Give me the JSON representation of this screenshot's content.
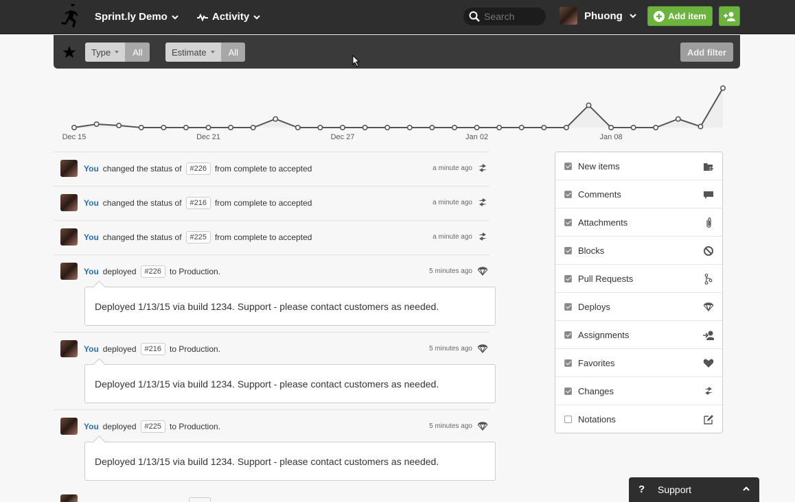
{
  "topbar": {
    "project": "Sprint.ly Demo",
    "activity": "Activity",
    "search_placeholder": "Search",
    "user_name": "Phuong",
    "add_item_label": "Add item"
  },
  "filterbar": {
    "type_label": "Type",
    "type_value": "All",
    "estimate_label": "Estimate",
    "estimate_value": "All",
    "add_filter_label": "Add filter"
  },
  "chart_data": {
    "type": "line",
    "x_tick_labels": [
      "Dec 15",
      "Dec 21",
      "Dec 27",
      "Jan 02",
      "Jan 08"
    ],
    "values": [
      0,
      1,
      0.6,
      0,
      0,
      0,
      0,
      0,
      0,
      2.5,
      0,
      0,
      0,
      0,
      0,
      0,
      0,
      0,
      0,
      0,
      0,
      0,
      0,
      6.5,
      0,
      0,
      0,
      2.5,
      0.3,
      11.5
    ],
    "ylim": [
      0,
      12
    ],
    "grid": false,
    "line_color": "#555555",
    "fill_color": "#eeeeee"
  },
  "feed": [
    {
      "kind": "status",
      "actor": "You",
      "text": "changed the status of",
      "tag": "#226",
      "rest": "from complete to accepted",
      "time": "a minute ago",
      "icon": "change-icon"
    },
    {
      "kind": "status",
      "actor": "You",
      "text": "changed the status of",
      "tag": "#216",
      "rest": "from complete to accepted",
      "time": "a minute ago",
      "icon": "change-icon"
    },
    {
      "kind": "status",
      "actor": "You",
      "text": "changed the status of",
      "tag": "#225",
      "rest": "from complete to accepted",
      "time": "a minute ago",
      "icon": "change-icon"
    },
    {
      "kind": "deploy",
      "actor": "You",
      "text": "deployed",
      "tag": "#226",
      "rest": "to Production.",
      "time": "5 minutes ago",
      "icon": "parachute-icon",
      "message": "Deployed 1/13/15 via build 1234. Support - please contact customers as needed."
    },
    {
      "kind": "deploy",
      "actor": "You",
      "text": "deployed",
      "tag": "#216",
      "rest": "to Production.",
      "time": "5 minutes ago",
      "icon": "parachute-icon",
      "message": "Deployed 1/13/15 via build 1234. Support - please contact customers as needed."
    },
    {
      "kind": "deploy",
      "actor": "You",
      "text": "deployed",
      "tag": "#225",
      "rest": "to Production.",
      "time": "5 minutes ago",
      "icon": "parachute-icon",
      "message": "Deployed 1/13/15 via build 1234. Support - please contact customers as needed."
    }
  ],
  "filters": [
    {
      "label": "New items",
      "checked": true,
      "icon": "new-item-icon"
    },
    {
      "label": "Comments",
      "checked": true,
      "icon": "comment-icon"
    },
    {
      "label": "Attachments",
      "checked": true,
      "icon": "paperclip-icon"
    },
    {
      "label": "Blocks",
      "checked": true,
      "icon": "block-icon"
    },
    {
      "label": "Pull Requests",
      "checked": true,
      "icon": "pull-request-icon"
    },
    {
      "label": "Deploys",
      "checked": true,
      "icon": "parachute-icon"
    },
    {
      "label": "Assignments",
      "checked": true,
      "icon": "assign-user-icon"
    },
    {
      "label": "Favorites",
      "checked": true,
      "icon": "heart-icon"
    },
    {
      "label": "Changes",
      "checked": true,
      "icon": "change-icon"
    },
    {
      "label": "Notations",
      "checked": false,
      "icon": "edit-icon"
    }
  ],
  "support": {
    "label": "Support",
    "q": "?"
  },
  "colors": {
    "accent_green": "#6cb33f",
    "link_blue": "#2a6eaa",
    "topbar": "#2e2e2e"
  }
}
